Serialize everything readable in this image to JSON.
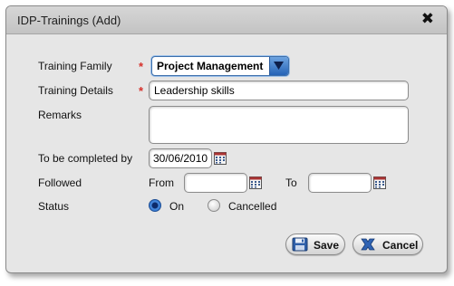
{
  "dialog": {
    "title": "IDP-Trainings (Add)",
    "close_icon": "close-icon"
  },
  "form": {
    "training_family": {
      "label": "Training Family",
      "required": true,
      "required_mark": "*",
      "value": "Project Management"
    },
    "training_details": {
      "label": "Training Details",
      "required": true,
      "required_mark": "*",
      "value": "Leadership skills"
    },
    "remarks": {
      "label": "Remarks",
      "value": ""
    },
    "completed_by": {
      "label": "To be completed by",
      "value": "30/06/2010",
      "icon": "calendar-icon"
    },
    "followed": {
      "label": "Followed",
      "from_label": "From",
      "from_value": "",
      "to_label": "To",
      "to_value": ""
    },
    "status": {
      "label": "Status",
      "options": [
        {
          "label": "On",
          "selected": true
        },
        {
          "label": "Cancelled",
          "selected": false
        }
      ]
    }
  },
  "buttons": {
    "save_label": "Save",
    "cancel_label": "Cancel"
  },
  "colors": {
    "required": "#d6302a",
    "accent": "#2462b6",
    "dialog_bg": "#e6e6e6"
  }
}
